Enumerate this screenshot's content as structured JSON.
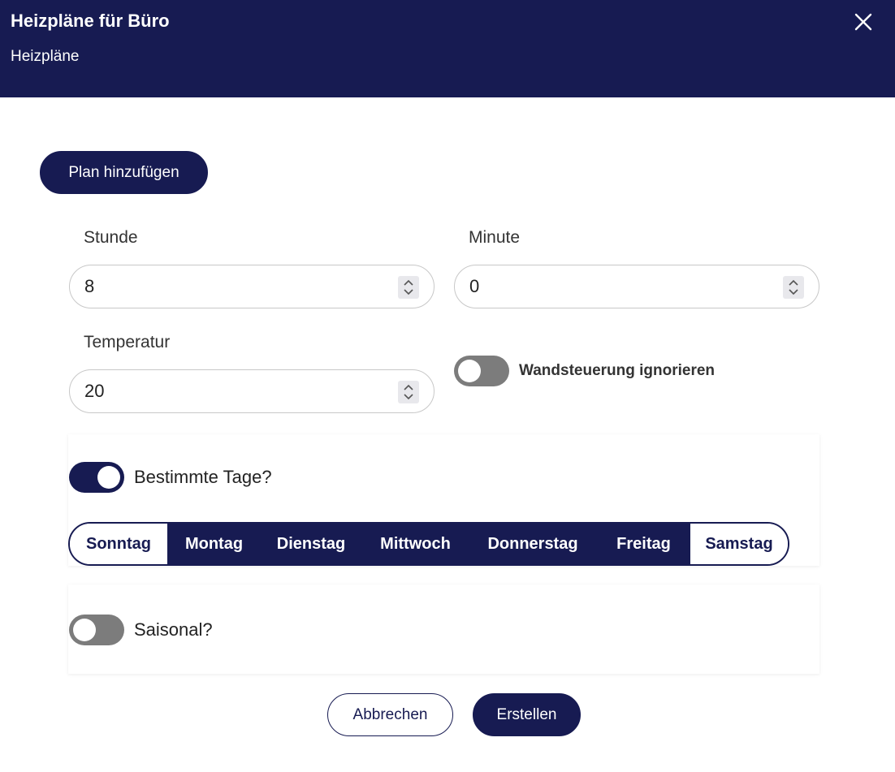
{
  "header": {
    "title": "Heizpläne für Büro",
    "subtitle": "Heizpläne",
    "close_icon": "close-icon"
  },
  "add_plan_label": "Plan hinzufügen",
  "hour": {
    "label": "Stunde",
    "value": "8"
  },
  "minute": {
    "label": "Minute",
    "value": "0"
  },
  "temperature": {
    "label": "Temperatur",
    "value": "20"
  },
  "wall_control": {
    "label": "Wandsteuerung ignorieren",
    "enabled": false
  },
  "specific_days": {
    "label": "Bestimmte Tage?",
    "enabled": true,
    "days": [
      {
        "label": "Sonntag",
        "selected": false
      },
      {
        "label": "Montag",
        "selected": true
      },
      {
        "label": "Dienstag",
        "selected": true
      },
      {
        "label": "Mittwoch",
        "selected": true
      },
      {
        "label": "Donnerstag",
        "selected": true
      },
      {
        "label": "Freitag",
        "selected": true
      },
      {
        "label": "Samstag",
        "selected": false
      }
    ]
  },
  "seasonal": {
    "label": "Saisonal?",
    "enabled": false
  },
  "footer": {
    "cancel_label": "Abbrechen",
    "create_label": "Erstellen"
  },
  "colors": {
    "primary": "#171b52",
    "toggle_off": "#7c7c7c"
  }
}
